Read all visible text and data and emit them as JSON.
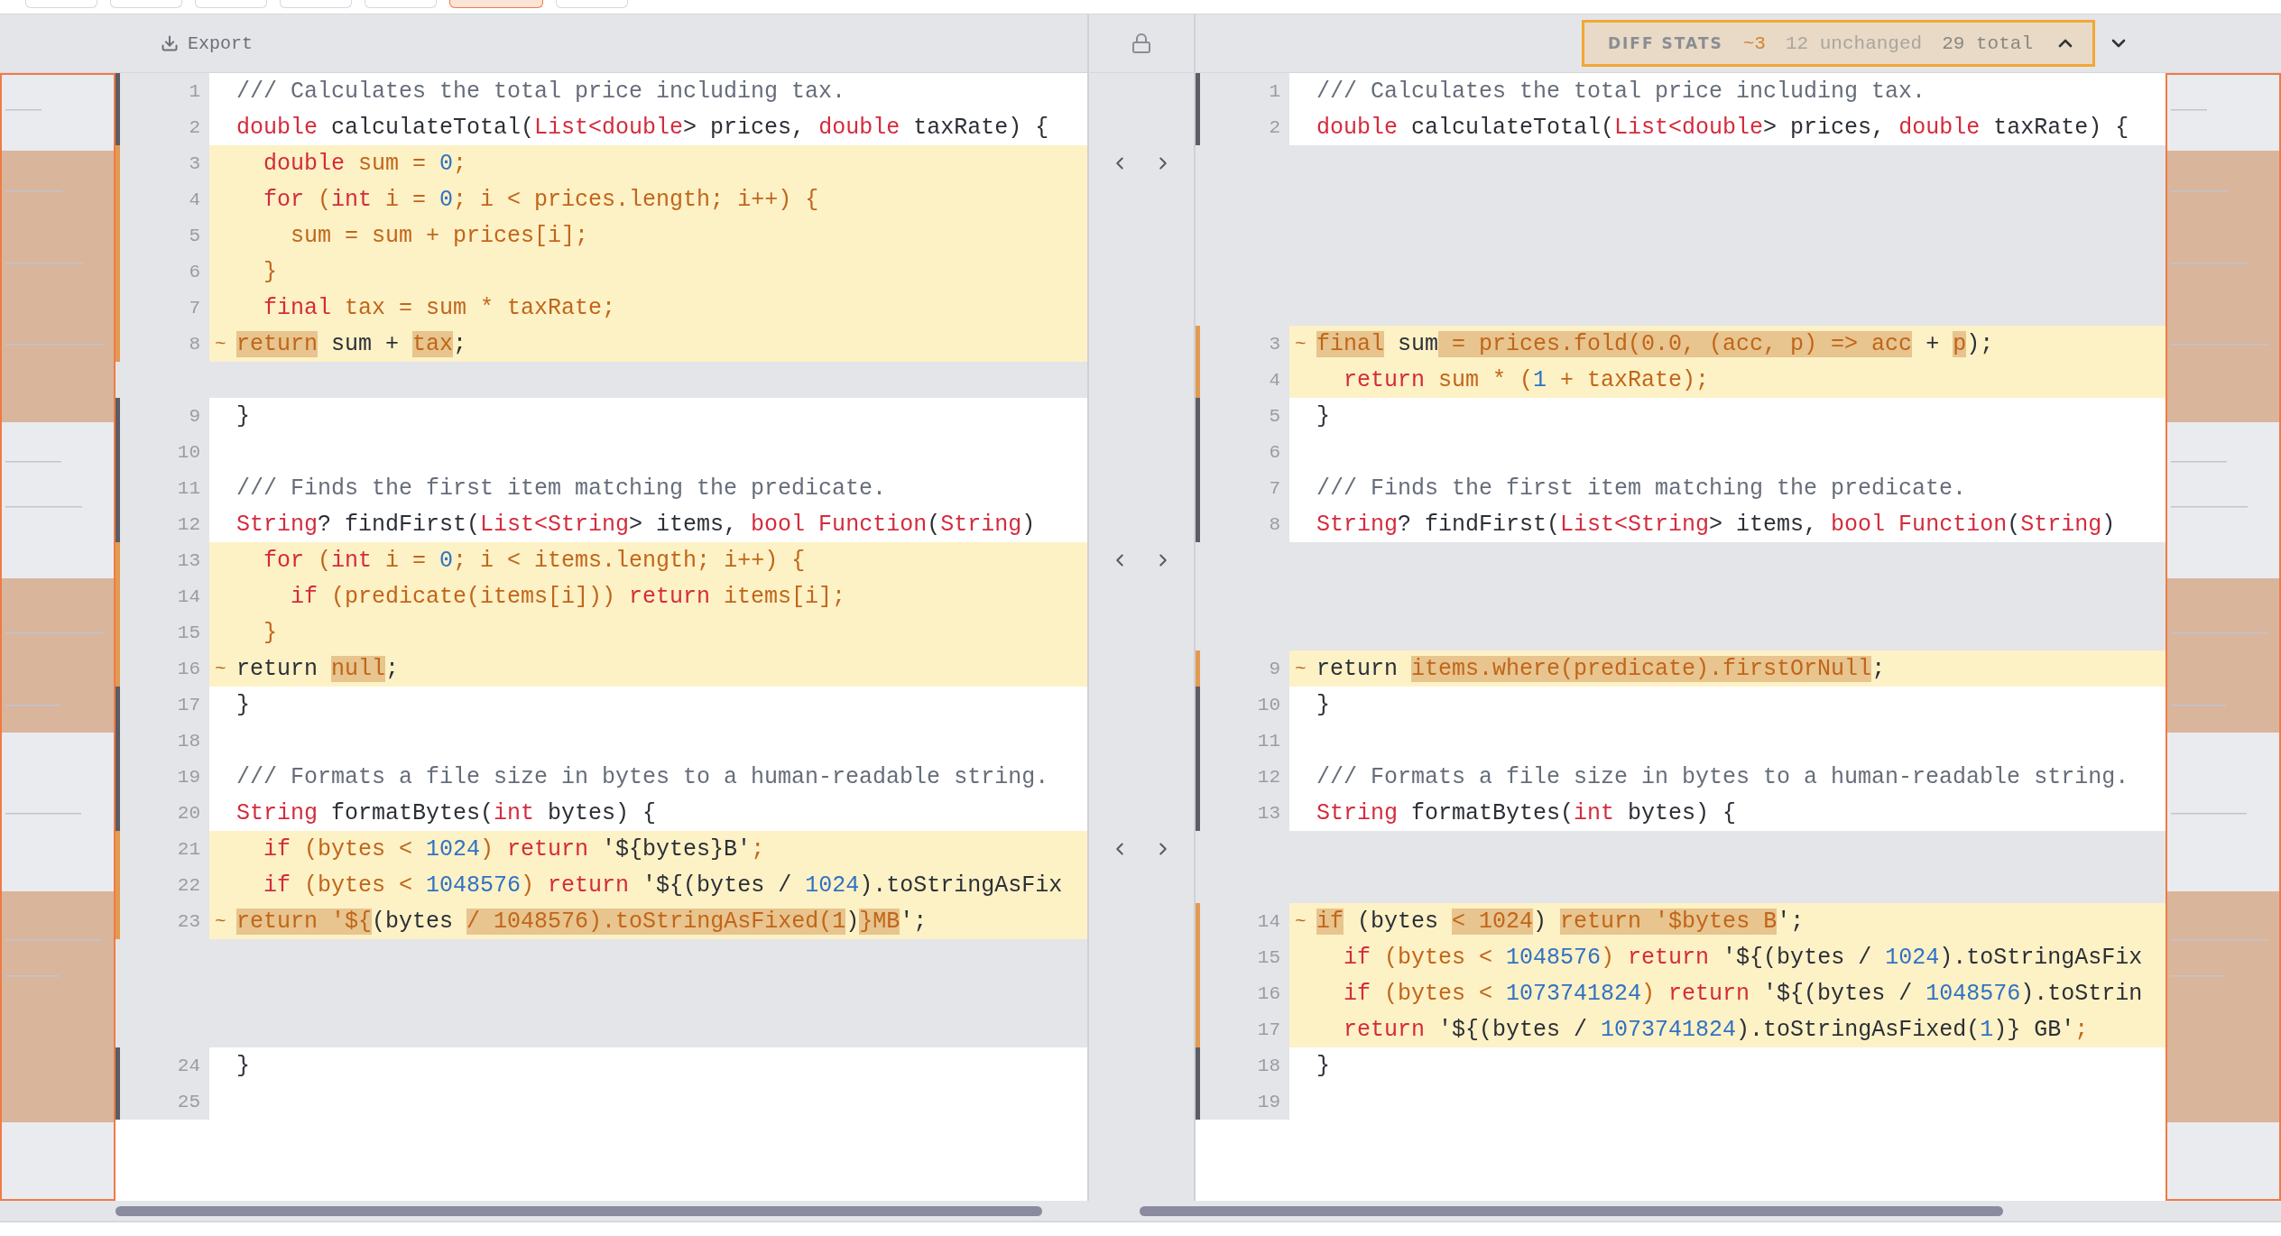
{
  "toolbar": {
    "buttons": [
      {
        "selected": false
      },
      {
        "selected": false
      },
      {
        "selected": false
      },
      {
        "selected": false
      },
      {
        "selected": false
      },
      {
        "selected": true
      },
      {
        "selected": false
      }
    ]
  },
  "header": {
    "export_label": "Export",
    "stats": {
      "label": "DIFF STATS",
      "modified": "~3",
      "unchanged": "12 unchanged",
      "total": "29 total"
    }
  },
  "rows": [
    {
      "left": {
        "kind": "line",
        "number": "1",
        "changed": false,
        "tokens": [
          {
            "text": "/// Calculates the total price including tax.",
            "kind": "com",
            "m": false
          }
        ]
      },
      "right": {
        "kind": "line",
        "number": "1",
        "changed": false,
        "tokens": [
          {
            "text": "/// Calculates the total price including tax.",
            "kind": "com",
            "m": false
          }
        ]
      }
    },
    {
      "left": {
        "kind": "line",
        "number": "2",
        "changed": false,
        "tokens": [
          {
            "text": "double",
            "kind": "kw",
            "m": false
          },
          {
            "text": " calculateTotal(",
            "kind": "txt",
            "m": false
          },
          {
            "text": "List<double",
            "kind": "kw",
            "m": false
          },
          {
            "text": "> prices, ",
            "kind": "txt",
            "m": false
          },
          {
            "text": "double",
            "kind": "kw",
            "m": false
          },
          {
            "text": " taxRate) {",
            "kind": "txt",
            "m": false
          }
        ]
      },
      "right": {
        "kind": "line",
        "number": "2",
        "changed": false,
        "tokens": [
          {
            "text": "double",
            "kind": "kw",
            "m": false
          },
          {
            "text": " calculateTotal(",
            "kind": "txt",
            "m": false
          },
          {
            "text": "List<double",
            "kind": "kw",
            "m": false
          },
          {
            "text": "> prices, ",
            "kind": "txt",
            "m": false
          },
          {
            "text": "double",
            "kind": "kw",
            "m": false
          },
          {
            "text": " taxRate) {",
            "kind": "txt",
            "m": false
          }
        ]
      }
    },
    {
      "left": {
        "kind": "line",
        "number": "3",
        "changed": true,
        "tokens": [
          {
            "text": "  double",
            "kind": "kw",
            "m": false
          },
          {
            "text": " sum = ",
            "kind": "chg",
            "m": false
          },
          {
            "text": "0",
            "kind": "num",
            "m": false
          },
          {
            "text": ";",
            "kind": "chg",
            "m": false
          }
        ]
      },
      "right": {
        "kind": "filler"
      }
    },
    {
      "left": {
        "kind": "line",
        "number": "4",
        "changed": true,
        "tokens": [
          {
            "text": "  for",
            "kind": "kw",
            "m": false
          },
          {
            "text": " (",
            "kind": "chg",
            "m": false
          },
          {
            "text": "int",
            "kind": "kw",
            "m": false
          },
          {
            "text": " i = ",
            "kind": "chg",
            "m": false
          },
          {
            "text": "0",
            "kind": "num",
            "m": false
          },
          {
            "text": "; i < prices.length; i++) {",
            "kind": "chg",
            "m": false
          }
        ]
      },
      "right": {
        "kind": "filler"
      }
    },
    {
      "left": {
        "kind": "line",
        "number": "5",
        "changed": true,
        "tokens": [
          {
            "text": "    sum = sum + prices[i];",
            "kind": "chg",
            "m": false
          }
        ]
      },
      "right": {
        "kind": "filler"
      }
    },
    {
      "left": {
        "kind": "line",
        "number": "6",
        "changed": true,
        "tokens": [
          {
            "text": "  }",
            "kind": "chg",
            "m": false
          }
        ]
      },
      "right": {
        "kind": "filler"
      }
    },
    {
      "left": {
        "kind": "line",
        "number": "7",
        "changed": true,
        "tokens": [
          {
            "text": "  final",
            "kind": "kw",
            "m": false
          },
          {
            "text": " tax = sum * taxRate;",
            "kind": "chg",
            "m": false
          }
        ]
      },
      "right": {
        "kind": "filler"
      }
    },
    {
      "left": {
        "kind": "line",
        "number": "8",
        "changed": true,
        "marker": "~",
        "tokens": [
          {
            "text": "return",
            "kind": "chg",
            "m": true
          },
          {
            "text": " sum + ",
            "kind": "txt",
            "m": false
          },
          {
            "text": "tax",
            "kind": "chg",
            "m": true
          },
          {
            "text": ";",
            "kind": "txt",
            "m": false
          }
        ]
      },
      "right": {
        "kind": "line",
        "number": "3",
        "changed": true,
        "marker": "~",
        "tokens": [
          {
            "text": "final",
            "kind": "chg",
            "m": true
          },
          {
            "text": " sum",
            "kind": "txt",
            "m": false
          },
          {
            "text": " = prices.fold(0.0, (acc, p) => acc",
            "kind": "chg",
            "m": true
          },
          {
            "text": " + ",
            "kind": "txt",
            "m": false
          },
          {
            "text": "p",
            "kind": "chg",
            "m": true
          },
          {
            "text": ");",
            "kind": "txt",
            "m": false
          }
        ]
      }
    },
    {
      "left": {
        "kind": "filler"
      },
      "right": {
        "kind": "line",
        "number": "4",
        "changed": true,
        "tokens": [
          {
            "text": "  return",
            "kind": "kw",
            "m": false
          },
          {
            "text": " sum * (",
            "kind": "chg",
            "m": false
          },
          {
            "text": "1",
            "kind": "num",
            "m": false
          },
          {
            "text": " + taxRate);",
            "kind": "chg",
            "m": false
          }
        ]
      }
    },
    {
      "left": {
        "kind": "line",
        "number": "9",
        "changed": false,
        "tokens": [
          {
            "text": "}",
            "kind": "txt",
            "m": false
          }
        ]
      },
      "right": {
        "kind": "line",
        "number": "5",
        "changed": false,
        "tokens": [
          {
            "text": "}",
            "kind": "txt",
            "m": false
          }
        ]
      }
    },
    {
      "left": {
        "kind": "line",
        "number": "10",
        "changed": false
      },
      "right": {
        "kind": "line",
        "number": "6",
        "changed": false
      }
    },
    {
      "left": {
        "kind": "line",
        "number": "11",
        "changed": false,
        "tokens": [
          {
            "text": "/// Finds the first item matching the predicate.",
            "kind": "com",
            "m": false
          }
        ]
      },
      "right": {
        "kind": "line",
        "number": "7",
        "changed": false,
        "tokens": [
          {
            "text": "/// Finds the first item matching the predicate.",
            "kind": "com",
            "m": false
          }
        ]
      }
    },
    {
      "left": {
        "kind": "line",
        "number": "12",
        "changed": false,
        "tokens": [
          {
            "text": "String",
            "kind": "kw",
            "m": false
          },
          {
            "text": "? findFirst(",
            "kind": "txt",
            "m": false
          },
          {
            "text": "List<String",
            "kind": "kw",
            "m": false
          },
          {
            "text": "> items, ",
            "kind": "txt",
            "m": false
          },
          {
            "text": "bool Function",
            "kind": "kw",
            "m": false
          },
          {
            "text": "(",
            "kind": "txt",
            "m": false
          },
          {
            "text": "String",
            "kind": "kw",
            "m": false
          },
          {
            "text": ")",
            "kind": "txt",
            "m": false
          }
        ]
      },
      "right": {
        "kind": "line",
        "number": "8",
        "changed": false,
        "tokens": [
          {
            "text": "String",
            "kind": "kw",
            "m": false
          },
          {
            "text": "? findFirst(",
            "kind": "txt",
            "m": false
          },
          {
            "text": "List<String",
            "kind": "kw",
            "m": false
          },
          {
            "text": "> items, ",
            "kind": "txt",
            "m": false
          },
          {
            "text": "bool Function",
            "kind": "kw",
            "m": false
          },
          {
            "text": "(",
            "kind": "txt",
            "m": false
          },
          {
            "text": "String",
            "kind": "kw",
            "m": false
          },
          {
            "text": ")",
            "kind": "txt",
            "m": false
          }
        ]
      }
    },
    {
      "left": {
        "kind": "line",
        "number": "13",
        "changed": true,
        "tokens": [
          {
            "text": "  for",
            "kind": "kw",
            "m": false
          },
          {
            "text": " (",
            "kind": "chg",
            "m": false
          },
          {
            "text": "int",
            "kind": "kw",
            "m": false
          },
          {
            "text": " i = ",
            "kind": "chg",
            "m": false
          },
          {
            "text": "0",
            "kind": "num",
            "m": false
          },
          {
            "text": "; i < items.length; i++) {",
            "kind": "chg",
            "m": false
          }
        ]
      },
      "right": {
        "kind": "filler"
      }
    },
    {
      "left": {
        "kind": "line",
        "number": "14",
        "changed": true,
        "tokens": [
          {
            "text": "    if",
            "kind": "kw",
            "m": false
          },
          {
            "text": " (predicate(items[i])) ",
            "kind": "chg",
            "m": false
          },
          {
            "text": "return",
            "kind": "kw",
            "m": false
          },
          {
            "text": " items[i];",
            "kind": "chg",
            "m": false
          }
        ]
      },
      "right": {
        "kind": "filler"
      }
    },
    {
      "left": {
        "kind": "line",
        "number": "15",
        "changed": true,
        "tokens": [
          {
            "text": "  }",
            "kind": "chg",
            "m": false
          }
        ]
      },
      "right": {
        "kind": "filler"
      }
    },
    {
      "left": {
        "kind": "line",
        "number": "16",
        "changed": true,
        "marker": "~",
        "tokens": [
          {
            "text": "return ",
            "kind": "txt",
            "m": false
          },
          {
            "text": "null",
            "kind": "chg",
            "m": true
          },
          {
            "text": ";",
            "kind": "txt",
            "m": false
          }
        ]
      },
      "right": {
        "kind": "line",
        "number": "9",
        "changed": true,
        "marker": "~",
        "tokens": [
          {
            "text": "return ",
            "kind": "txt",
            "m": false
          },
          {
            "text": "items.where(predicate).firstOrNull",
            "kind": "chg",
            "m": true
          },
          {
            "text": ";",
            "kind": "txt",
            "m": false
          }
        ]
      }
    },
    {
      "left": {
        "kind": "line",
        "number": "17",
        "changed": false,
        "tokens": [
          {
            "text": "}",
            "kind": "txt",
            "m": false
          }
        ]
      },
      "right": {
        "kind": "line",
        "number": "10",
        "changed": false,
        "tokens": [
          {
            "text": "}",
            "kind": "txt",
            "m": false
          }
        ]
      }
    },
    {
      "left": {
        "kind": "line",
        "number": "18",
        "changed": false
      },
      "right": {
        "kind": "line",
        "number": "11",
        "changed": false
      }
    },
    {
      "left": {
        "kind": "line",
        "number": "19",
        "changed": false,
        "tokens": [
          {
            "text": "/// Formats a file size in bytes to a human-readable string.",
            "kind": "com",
            "m": false
          }
        ]
      },
      "right": {
        "kind": "line",
        "number": "12",
        "changed": false,
        "tokens": [
          {
            "text": "/// Formats a file size in bytes to a human-readable string.",
            "kind": "com",
            "m": false
          }
        ]
      }
    },
    {
      "left": {
        "kind": "line",
        "number": "20",
        "changed": false,
        "tokens": [
          {
            "text": "String",
            "kind": "kw",
            "m": false
          },
          {
            "text": " formatBytes(",
            "kind": "txt",
            "m": false
          },
          {
            "text": "int",
            "kind": "kw",
            "m": false
          },
          {
            "text": " bytes) {",
            "kind": "txt",
            "m": false
          }
        ]
      },
      "right": {
        "kind": "line",
        "number": "13",
        "changed": false,
        "tokens": [
          {
            "text": "String",
            "kind": "kw",
            "m": false
          },
          {
            "text": " formatBytes(",
            "kind": "txt",
            "m": false
          },
          {
            "text": "int",
            "kind": "kw",
            "m": false
          },
          {
            "text": " bytes) {",
            "kind": "txt",
            "m": false
          }
        ]
      }
    },
    {
      "left": {
        "kind": "line",
        "number": "21",
        "changed": true,
        "tokens": [
          {
            "text": "  if",
            "kind": "kw",
            "m": false
          },
          {
            "text": " (bytes < ",
            "kind": "chg",
            "m": false
          },
          {
            "text": "1024",
            "kind": "num",
            "m": false
          },
          {
            "text": ") ",
            "kind": "chg",
            "m": false
          },
          {
            "text": "return",
            "kind": "kw",
            "m": false
          },
          {
            "text": " '${bytes}B'",
            "kind": "txt",
            "m": false
          },
          {
            "text": ";",
            "kind": "chg",
            "m": false
          }
        ]
      },
      "right": {
        "kind": "filler"
      }
    },
    {
      "left": {
        "kind": "line",
        "number": "22",
        "changed": true,
        "tokens": [
          {
            "text": "  if",
            "kind": "kw",
            "m": false
          },
          {
            "text": " (bytes < ",
            "kind": "chg",
            "m": false
          },
          {
            "text": "1048576",
            "kind": "num",
            "m": false
          },
          {
            "text": ") ",
            "kind": "chg",
            "m": false
          },
          {
            "text": "return",
            "kind": "kw",
            "m": false
          },
          {
            "text": " '${(bytes / ",
            "kind": "txt",
            "m": false
          },
          {
            "text": "1024",
            "kind": "num",
            "m": false
          },
          {
            "text": ").toStringAsFix",
            "kind": "txt",
            "m": false
          }
        ]
      },
      "right": {
        "kind": "filler"
      }
    },
    {
      "left": {
        "kind": "line",
        "number": "23",
        "changed": true,
        "marker": "~",
        "tokens": [
          {
            "text": "return ",
            "kind": "chg",
            "m": true
          },
          {
            "text": "'${",
            "kind": "chg",
            "m": true
          },
          {
            "text": "(bytes ",
            "kind": "txt",
            "m": false
          },
          {
            "text": "/ ",
            "kind": "chg",
            "m": true
          },
          {
            "text": "1048576).toStringAsFixed(1",
            "kind": "chg",
            "m": true
          },
          {
            "text": ")",
            "kind": "txt",
            "m": false
          },
          {
            "text": "}MB",
            "kind": "chg",
            "m": true
          },
          {
            "text": "';",
            "kind": "txt",
            "m": false
          }
        ]
      },
      "right": {
        "kind": "line",
        "number": "14",
        "changed": true,
        "marker": "~",
        "tokens": [
          {
            "text": "if",
            "kind": "chg",
            "m": true
          },
          {
            "text": " (bytes ",
            "kind": "txt",
            "m": false
          },
          {
            "text": "< ",
            "kind": "chg",
            "m": true
          },
          {
            "text": "1024",
            "kind": "chg",
            "m": true
          },
          {
            "text": ") ",
            "kind": "txt",
            "m": false
          },
          {
            "text": "return '$bytes B",
            "kind": "chg",
            "m": true
          },
          {
            "text": "';",
            "kind": "txt",
            "m": false
          }
        ]
      }
    },
    {
      "left": {
        "kind": "filler"
      },
      "right": {
        "kind": "line",
        "number": "15",
        "changed": true,
        "tokens": [
          {
            "text": "  if",
            "kind": "kw",
            "m": false
          },
          {
            "text": " (bytes < ",
            "kind": "chg",
            "m": false
          },
          {
            "text": "1048576",
            "kind": "num",
            "m": false
          },
          {
            "text": ") ",
            "kind": "chg",
            "m": false
          },
          {
            "text": "return",
            "kind": "kw",
            "m": false
          },
          {
            "text": " '${(bytes / ",
            "kind": "txt",
            "m": false
          },
          {
            "text": "1024",
            "kind": "num",
            "m": false
          },
          {
            "text": ").toStringAsFix",
            "kind": "txt",
            "m": false
          }
        ]
      }
    },
    {
      "left": {
        "kind": "filler"
      },
      "right": {
        "kind": "line",
        "number": "16",
        "changed": true,
        "tokens": [
          {
            "text": "  if",
            "kind": "kw",
            "m": false
          },
          {
            "text": " (bytes < ",
            "kind": "chg",
            "m": false
          },
          {
            "text": "1073741824",
            "kind": "num",
            "m": false
          },
          {
            "text": ") ",
            "kind": "chg",
            "m": false
          },
          {
            "text": "return",
            "kind": "kw",
            "m": false
          },
          {
            "text": " '${(bytes / ",
            "kind": "txt",
            "m": false
          },
          {
            "text": "1048576",
            "kind": "num",
            "m": false
          },
          {
            "text": ").toStrin",
            "kind": "txt",
            "m": false
          }
        ]
      }
    },
    {
      "left": {
        "kind": "filler"
      },
      "right": {
        "kind": "line",
        "number": "17",
        "changed": true,
        "tokens": [
          {
            "text": "  return",
            "kind": "kw",
            "m": false
          },
          {
            "text": " '${(bytes / ",
            "kind": "txt",
            "m": false
          },
          {
            "text": "1073741824",
            "kind": "num",
            "m": false
          },
          {
            "text": ").toStringAsFixed(",
            "kind": "txt",
            "m": false
          },
          {
            "text": "1",
            "kind": "num",
            "m": false
          },
          {
            "text": ")} GB'",
            "kind": "txt",
            "m": false
          },
          {
            "text": ";",
            "kind": "chg",
            "m": false
          }
        ]
      }
    },
    {
      "left": {
        "kind": "line",
        "number": "24",
        "changed": false,
        "tokens": [
          {
            "text": "}",
            "kind": "txt",
            "m": false
          }
        ]
      },
      "right": {
        "kind": "line",
        "number": "18",
        "changed": false,
        "tokens": [
          {
            "text": "}",
            "kind": "txt",
            "m": false
          }
        ]
      }
    },
    {
      "left": {
        "kind": "line",
        "number": "25",
        "changed": false
      },
      "right": {
        "kind": "line",
        "number": "19",
        "changed": false
      }
    }
  ]
}
